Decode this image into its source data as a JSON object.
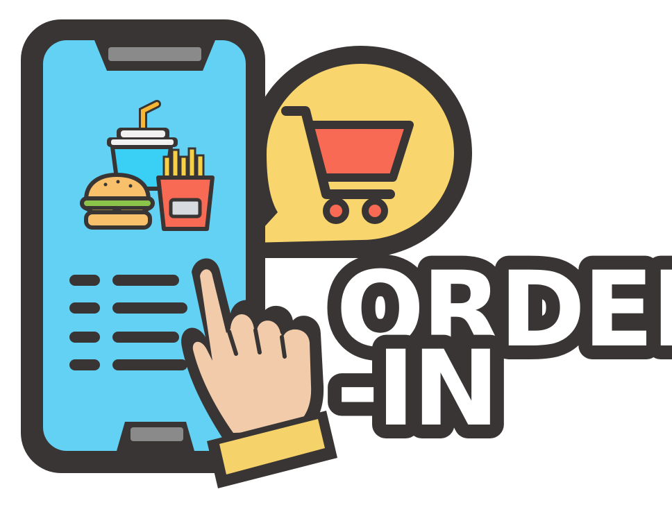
{
  "logo": {
    "line1": "ORDER",
    "line2": "-IN"
  },
  "icons": {
    "phone": "smartphone-icon",
    "drink": "soda-cup-icon",
    "burger": "burger-icon",
    "fries": "fries-icon",
    "cart": "shopping-cart-icon",
    "bubble": "speech-bubble-icon",
    "hand": "pointing-hand-icon"
  },
  "colors": {
    "outline": "#383534",
    "screen": "#63d1f3",
    "bubble": "#f9d56e",
    "cart": "#f86a54",
    "skin": "#f2cbab",
    "cuff": "#f6d36a",
    "text_fill": "#ffffff",
    "drink": "#3ad0f5"
  }
}
